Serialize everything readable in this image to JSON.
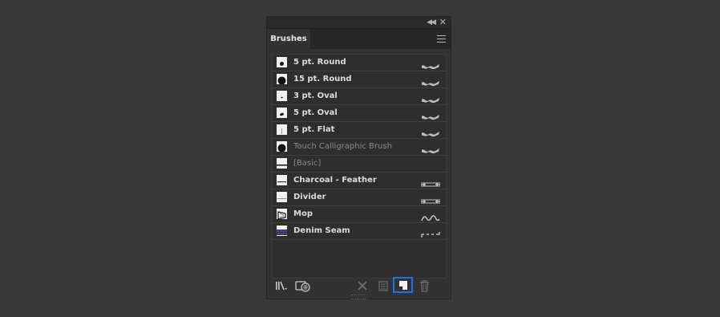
{
  "panel": {
    "tab_label": "Brushes"
  },
  "brushes": [
    {
      "name": "5 pt. Round",
      "dimmed": false,
      "thumb": "round-small",
      "stroke": "calligraphic"
    },
    {
      "name": "15 pt. Round",
      "dimmed": false,
      "thumb": "round-large",
      "stroke": "calligraphic"
    },
    {
      "name": "3 pt. Oval",
      "dimmed": false,
      "thumb": "oval-small",
      "stroke": "calligraphic"
    },
    {
      "name": "5 pt. Oval",
      "dimmed": false,
      "thumb": "oval",
      "stroke": "calligraphic"
    },
    {
      "name": "5 pt. Flat",
      "dimmed": false,
      "thumb": "flat",
      "stroke": "calligraphic"
    },
    {
      "name": "Touch Calligraphic Brush",
      "dimmed": true,
      "thumb": "round-large",
      "stroke": "calligraphic"
    },
    {
      "name": "[Basic]",
      "dimmed": true,
      "thumb": "basic",
      "stroke": "none"
    },
    {
      "name": "Charcoal - Feather",
      "dimmed": false,
      "thumb": "line",
      "stroke": "art"
    },
    {
      "name": "Divider",
      "dimmed": false,
      "thumb": "line-thin",
      "stroke": "art"
    },
    {
      "name": "Mop",
      "dimmed": false,
      "thumb": "mop",
      "stroke": "bristle"
    },
    {
      "name": "Denim Seam",
      "dimmed": false,
      "thumb": "denim",
      "stroke": "pattern"
    }
  ],
  "toolbar": {
    "icons": [
      "brush-libraries-icon",
      "libraries-panel-icon",
      "remove-stroke-icon",
      "brush-options-icon",
      "new-brush-icon",
      "delete-brush-icon"
    ]
  },
  "colors": {
    "panel_bg": "#323232",
    "selected_outline": "#1a73e8"
  }
}
